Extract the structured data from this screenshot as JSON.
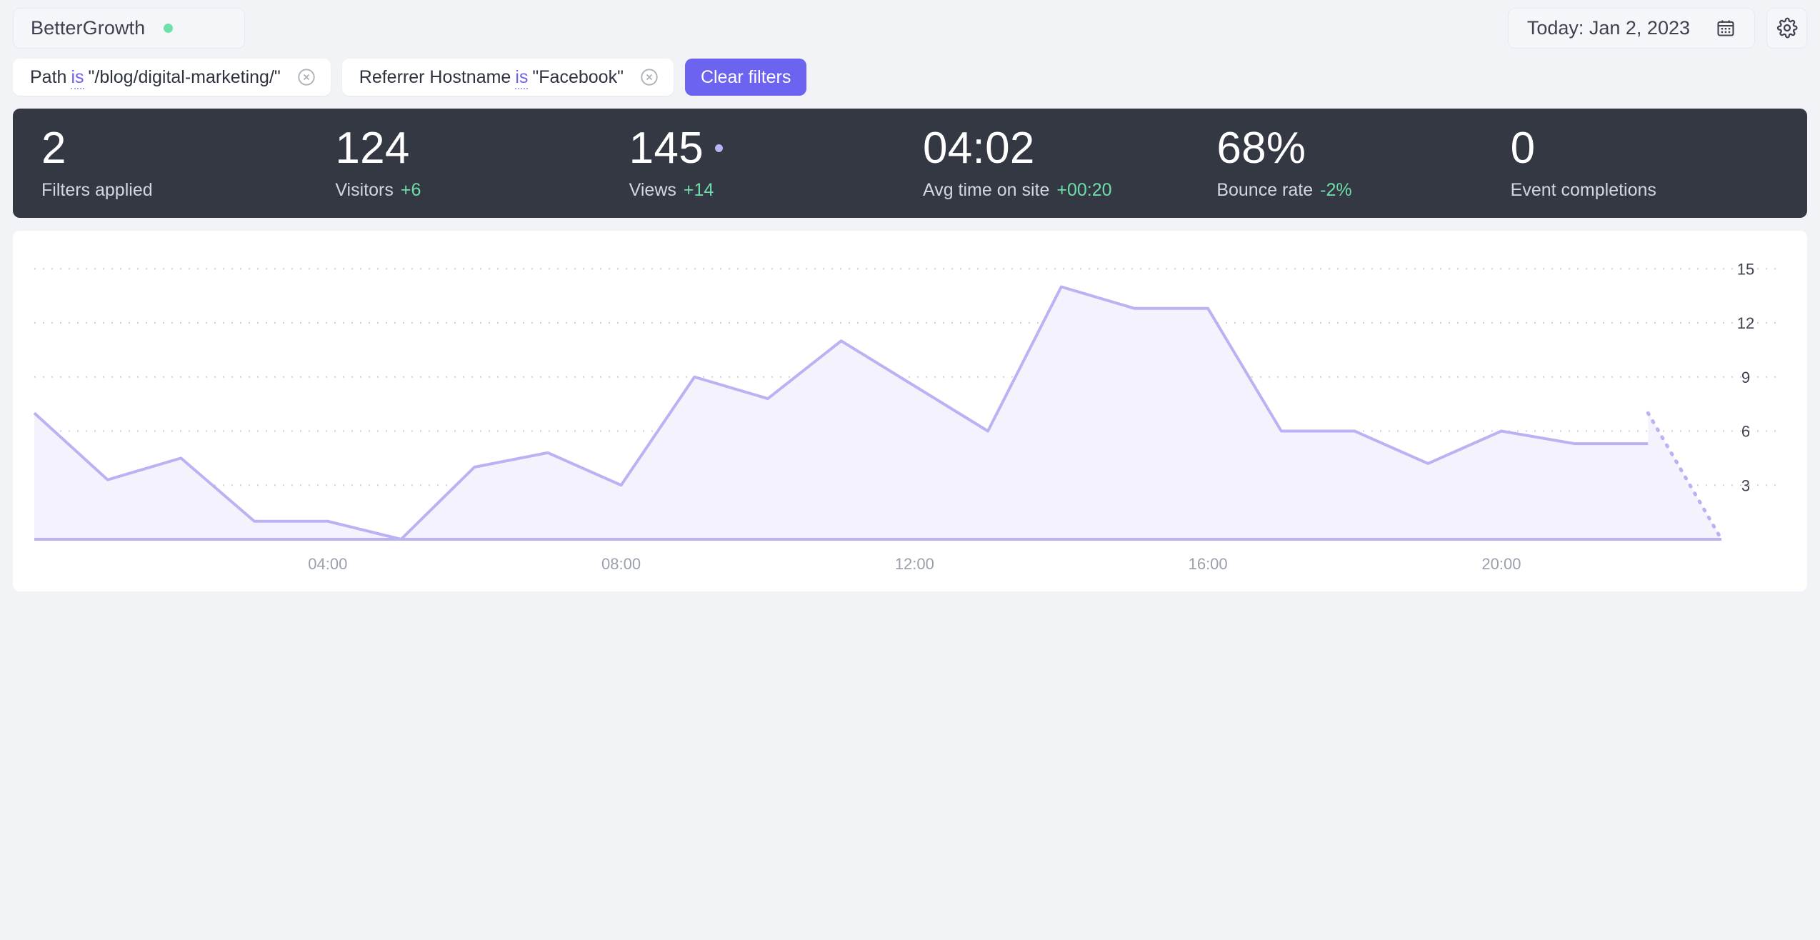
{
  "header": {
    "site_name": "BetterGrowth",
    "status_dot_color": "#6fe0a8",
    "date_label": "Today: Jan 2, 2023",
    "calendar_icon": "calendar-icon",
    "settings_icon": "gear-icon"
  },
  "filters": {
    "items": [
      {
        "key": "Path",
        "operator": "is",
        "value": "\"/blog/digital-marketing/\"",
        "remove_icon": "close-circle-icon"
      },
      {
        "key": "Referrer Hostname",
        "operator": "is",
        "value": "\"Facebook\"",
        "remove_icon": "close-circle-icon"
      }
    ],
    "clear_label": "Clear filters",
    "clear_color": "#6c63f0",
    "operator_color": "#6c63f0"
  },
  "stats": {
    "background": "#343842",
    "positive_color": "#6fddaa",
    "items": [
      {
        "value": "2",
        "label": "Filters applied",
        "delta": "",
        "live": false
      },
      {
        "value": "124",
        "label": "Visitors",
        "delta": "+6",
        "live": false
      },
      {
        "value": "145",
        "label": "Views",
        "delta": "+14",
        "live": true
      },
      {
        "value": "04:02",
        "label": "Avg time on site",
        "delta": "+00:20",
        "live": false
      },
      {
        "value": "68%",
        "label": "Bounce rate",
        "delta": "-2%",
        "live": false
      },
      {
        "value": "0",
        "label": "Event completions",
        "delta": "",
        "live": false
      }
    ]
  },
  "chart_data": {
    "type": "area",
    "title": "",
    "xlabel": "",
    "ylabel": "",
    "line_color": "#b9b3f4",
    "fill_color": "#f4f2fd",
    "grid": true,
    "legend": "none",
    "ylim": [
      0,
      16
    ],
    "yticks": [
      3,
      6,
      9,
      12,
      15
    ],
    "xticks": [
      "04:00",
      "08:00",
      "12:00",
      "16:00",
      "20:00"
    ],
    "xtick_indices": [
      4,
      8,
      12,
      16,
      20
    ],
    "x": [
      "00:00",
      "01:00",
      "02:00",
      "03:00",
      "04:00",
      "05:00",
      "06:00",
      "07:00",
      "08:00",
      "09:00",
      "10:00",
      "11:00",
      "12:00",
      "13:00",
      "14:00",
      "15:00",
      "16:00",
      "17:00",
      "18:00",
      "19:00",
      "20:00",
      "21:00",
      "22:00",
      "23:00"
    ],
    "series": [
      {
        "name": "Visitors",
        "values": [
          7,
          3.3,
          4.5,
          1,
          1,
          0,
          4,
          4.8,
          3,
          9,
          7.8,
          11,
          8.5,
          6,
          14,
          12.8,
          12.8,
          6,
          6,
          4.2,
          6,
          5.3,
          5.3,
          7
        ],
        "projected_from_index": 22,
        "projected_values": [
          7,
          0
        ]
      }
    ]
  }
}
